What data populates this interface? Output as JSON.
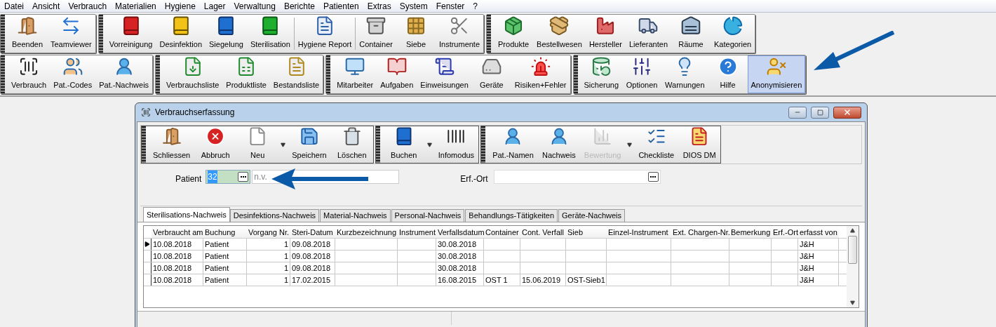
{
  "menu": [
    "Datei",
    "Ansicht",
    "Verbrauch",
    "Materialien",
    "Hygiene",
    "Lager",
    "Verwaltung",
    "Berichte",
    "Patienten",
    "Extras",
    "System",
    "Fenster",
    "?"
  ],
  "toolbar_rows": [
    [
      {
        "buttons": [
          {
            "label": "Beenden",
            "selected": false
          },
          {
            "label": "Teamviewer",
            "selected": false
          }
        ]
      },
      {
        "buttons": [
          {
            "label": "Vorreinigung",
            "selected": false
          },
          {
            "label": "Desinfektion",
            "selected": false
          },
          {
            "label": "Siegelung",
            "selected": false
          },
          {
            "label": "Sterilisation",
            "selected": false
          },
          {
            "label": "Hygiene Report",
            "selected": false,
            "separated": true
          },
          {
            "label": "Container",
            "selected": false,
            "separated": true
          },
          {
            "label": "Siebe",
            "selected": false
          },
          {
            "label": "Instrumente",
            "selected": false
          }
        ]
      },
      {
        "buttons": [
          {
            "label": "Produkte",
            "selected": false
          },
          {
            "label": "Bestellwesen",
            "selected": false
          },
          {
            "label": "Hersteller",
            "selected": false
          },
          {
            "label": "Lieferanten",
            "selected": false
          },
          {
            "label": "Räume",
            "selected": false
          },
          {
            "label": "Kategorien",
            "selected": false
          }
        ]
      }
    ],
    [
      {
        "buttons": [
          {
            "label": "Verbrauch",
            "selected": false
          },
          {
            "label": "Pat.-Codes",
            "selected": false
          },
          {
            "label": "Pat.-Nachweis",
            "selected": false
          }
        ]
      },
      {
        "buttons": [
          {
            "label": "Verbrauchsliste",
            "selected": false
          },
          {
            "label": "Produktliste",
            "selected": false
          },
          {
            "label": "Bestandsliste",
            "selected": false
          }
        ]
      },
      {
        "buttons": [
          {
            "label": "Mitarbeiter",
            "selected": false
          },
          {
            "label": "Aufgaben",
            "selected": false
          },
          {
            "label": "Einweisungen",
            "selected": false
          },
          {
            "label": "Geräte",
            "selected": false
          },
          {
            "label": "Risiken+Fehler",
            "selected": false
          }
        ]
      },
      {
        "buttons": [
          {
            "label": "Sicherung",
            "selected": false
          },
          {
            "label": "Optionen",
            "selected": false
          },
          {
            "label": "Warnungen",
            "selected": false
          },
          {
            "label": "Hilfe",
            "selected": false
          },
          {
            "label": "Anonymisieren",
            "selected": true
          }
        ]
      }
    ]
  ],
  "window": {
    "title": "Verbrauchserfassung",
    "toolbar": [
      {
        "buttons": [
          {
            "label": "Schliessen",
            "disabled": false,
            "dropdown": false
          },
          {
            "label": "Abbruch",
            "disabled": false,
            "dropdown": false
          },
          {
            "label": "Neu",
            "disabled": false,
            "dropdown": true
          },
          {
            "label": "Speichern",
            "disabled": false,
            "dropdown": false
          },
          {
            "label": "Löschen",
            "disabled": false,
            "dropdown": false
          }
        ]
      },
      {
        "buttons": [
          {
            "label": "Buchen",
            "disabled": false,
            "dropdown": true
          },
          {
            "label": "Infomodus",
            "disabled": false,
            "dropdown": false
          }
        ]
      },
      {
        "buttons": [
          {
            "label": "Pat.-Namen",
            "disabled": false,
            "dropdown": false
          },
          {
            "label": "Nachweis",
            "disabled": false,
            "dropdown": false
          },
          {
            "label": "Bewertung",
            "disabled": true,
            "dropdown": true
          },
          {
            "label": "Checkliste",
            "disabled": false,
            "dropdown": false
          },
          {
            "label": "DIOS DM",
            "disabled": false,
            "dropdown": false
          }
        ]
      }
    ],
    "patient": {
      "label": "Patient",
      "value": "32",
      "value_selected": true,
      "name": "n.v."
    },
    "erf_ort": {
      "label": "Erf.-Ort"
    },
    "tabs": [
      {
        "label": "Sterilisations-Nachweis",
        "selected": true
      },
      {
        "label": "Desinfektions-Nachweis",
        "selected": false
      },
      {
        "label": "Material-Nachweis",
        "selected": false
      },
      {
        "label": "Personal-Nachweis",
        "selected": false
      },
      {
        "label": "Behandlungs-Tätigkeiten",
        "selected": false
      },
      {
        "label": "Geräte-Nachweis",
        "selected": false
      }
    ],
    "table": {
      "columns": [
        "Verbraucht am",
        "Buchung",
        "Vorgang Nr.",
        "Steri-Datum",
        "Kurzbezeichnung",
        "Instrument",
        "Verfallsdatum",
        "Container",
        "Cont. Verfall",
        "Sieb",
        "Einzel-Instrument",
        "Ext. Chargen-Nr.",
        "Bemerkung",
        "Erf.-Ort",
        "erfasst von"
      ],
      "rows": [
        {
          "selected": true,
          "cells": [
            "10.08.2018",
            "Patient",
            "1",
            "09.08.2018",
            null,
            null,
            "30.08.2018",
            null,
            null,
            null,
            null,
            null,
            null,
            null,
            "J&H"
          ]
        },
        {
          "selected": false,
          "cells": [
            "10.08.2018",
            "Patient",
            "1",
            "09.08.2018",
            null,
            null,
            "30.08.2018",
            null,
            null,
            null,
            null,
            null,
            null,
            null,
            "J&H"
          ]
        },
        {
          "selected": false,
          "cells": [
            "10.08.2018",
            "Patient",
            "1",
            "09.08.2018",
            null,
            null,
            "30.08.2018",
            null,
            null,
            null,
            null,
            null,
            null,
            null,
            "J&H"
          ]
        },
        {
          "selected": false,
          "cells": [
            "10.08.2018",
            "Patient",
            "1",
            "17.02.2015",
            null,
            null,
            "16.08.2015",
            "OST 1",
            "15.06.2019",
            "OST-Sieb1",
            null,
            null,
            null,
            null,
            "J&H"
          ]
        }
      ]
    }
  }
}
